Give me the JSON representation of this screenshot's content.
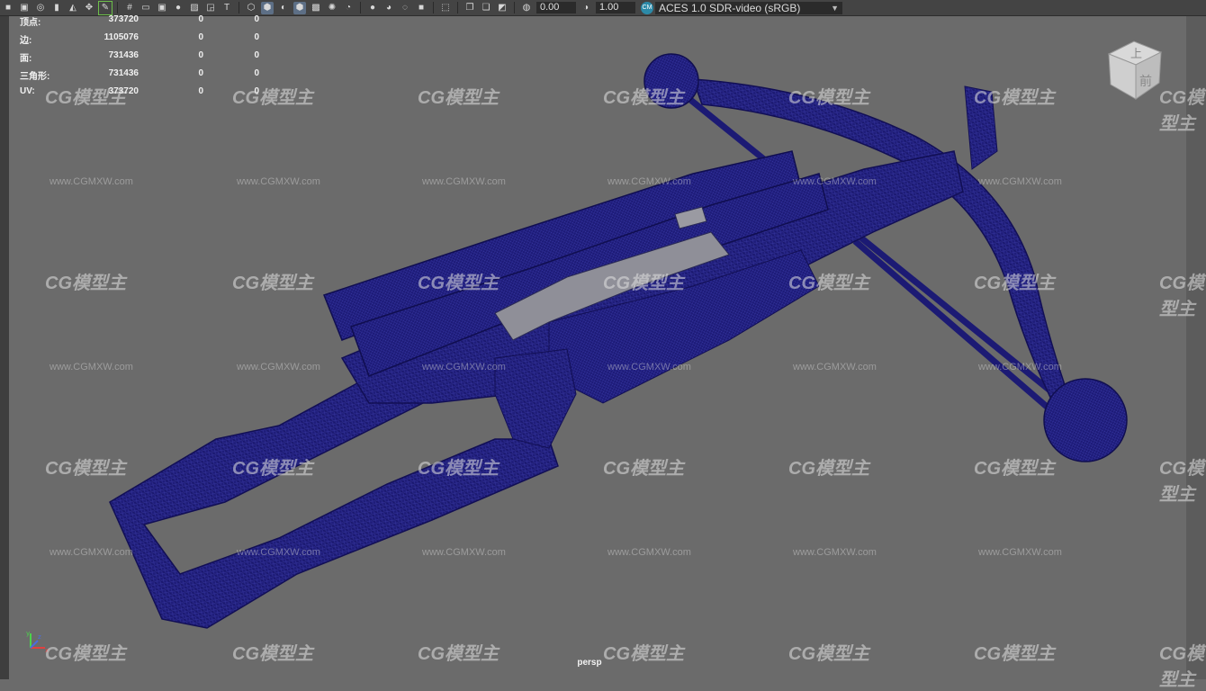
{
  "toolbar": {
    "exposure_value": "0.00",
    "gamma_value": "1.00",
    "color_space": "ACES 1.0 SDR-video (sRGB)",
    "color_management_badge": "CM"
  },
  "hud": {
    "rows": [
      {
        "label": "顶点:",
        "v1": "373720",
        "v2": "0",
        "v3": "0"
      },
      {
        "label": "边:",
        "v1": "1105076",
        "v2": "0",
        "v3": "0"
      },
      {
        "label": "面:",
        "v1": "731436",
        "v2": "0",
        "v3": "0"
      },
      {
        "label": "三角形:",
        "v1": "731436",
        "v2": "0",
        "v3": "0"
      },
      {
        "label": "UV:",
        "v1": "373720",
        "v2": "0",
        "v3": "0"
      }
    ]
  },
  "viewcube": {
    "top_label": "上",
    "front_label": "前"
  },
  "viewport": {
    "camera_name": "persp"
  },
  "axis_gizmo": {
    "x": "x",
    "y": "y",
    "z": "z"
  },
  "watermark": {
    "logo_text": "CG模型主",
    "url_text": "www.CGMXW.com"
  },
  "colors": {
    "wire": "#1f1d7a",
    "wire_dark": "#121050",
    "background": "#6b6b6b",
    "toolbar": "#444444"
  }
}
